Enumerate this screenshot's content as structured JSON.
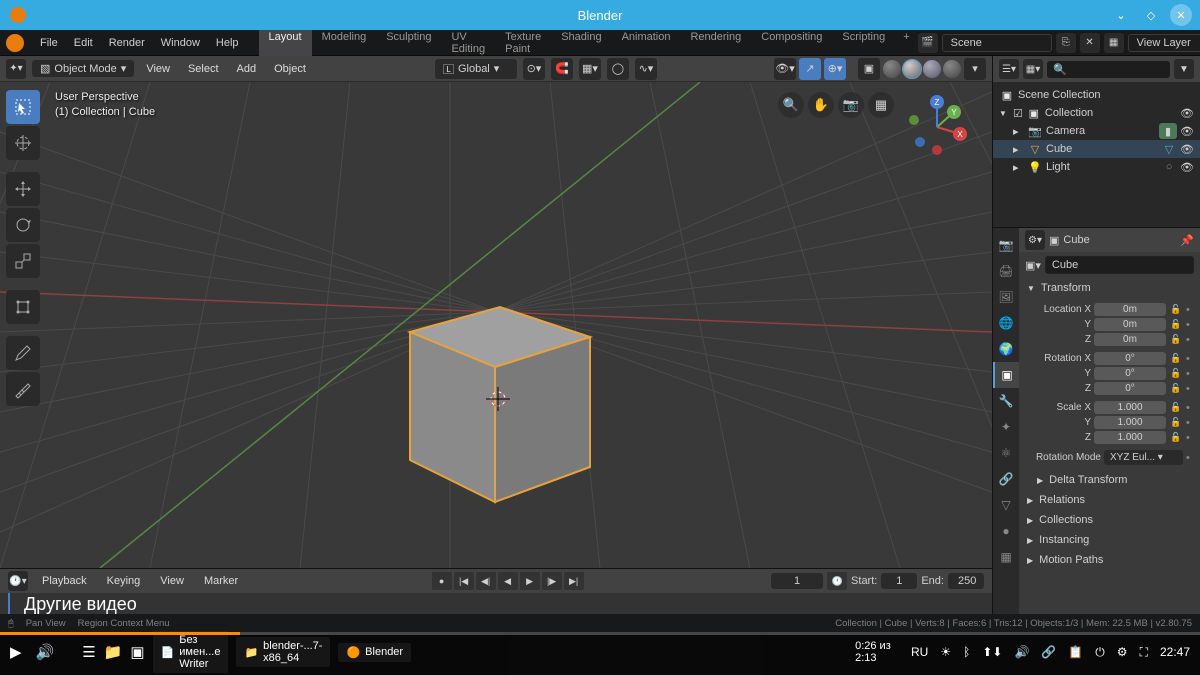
{
  "titlebar": {
    "title": "Blender"
  },
  "menu": {
    "file": "File",
    "edit": "Edit",
    "render": "Render",
    "window": "Window",
    "help": "Help"
  },
  "workspaces": {
    "layout": "Layout",
    "modeling": "Modeling",
    "sculpting": "Sculpting",
    "uv": "UV Editing",
    "texpaint": "Texture Paint",
    "shading": "Shading",
    "animation": "Animation",
    "rendering": "Rendering",
    "compositing": "Compositing",
    "scripting": "Scripting"
  },
  "scene": {
    "scene_label": "Scene",
    "layer_label": "View Layer"
  },
  "viewport_header": {
    "mode": "Object Mode",
    "view": "View",
    "select": "Select",
    "add": "Add",
    "object": "Object",
    "orientation": "Global"
  },
  "viewport_info": {
    "line1": "User Perspective",
    "line2": "(1) Collection | Cube"
  },
  "outliner": {
    "scene_collection": "Scene Collection",
    "collection": "Collection",
    "camera": "Camera",
    "cube": "Cube",
    "light": "Light"
  },
  "props": {
    "object_name": "Cube",
    "transform": "Transform",
    "loc_label": "Location X",
    "rot_label": "Rotation X",
    "scale_label": "Scale X",
    "y": "Y",
    "z": "Z",
    "loc_x": "0m",
    "loc_y": "0m",
    "loc_z": "0m",
    "rot_x": "0°",
    "rot_y": "0°",
    "rot_z": "0°",
    "scale_x": "1.000",
    "scale_y": "1.000",
    "scale_z": "1.000",
    "rotmode_label": "Rotation Mode",
    "rotmode": "XYZ Eul...",
    "delta": "Delta Transform",
    "relations": "Relations",
    "collections": "Collections",
    "instancing": "Instancing",
    "motion": "Motion Paths"
  },
  "timeline": {
    "playback": "Playback",
    "keying": "Keying",
    "view": "View",
    "marker": "Marker",
    "current": "1",
    "start_label": "Start:",
    "start": "1",
    "end_label": "End:",
    "end": "250"
  },
  "status": {
    "pan": "Pan View",
    "context": "Region Context Menu",
    "right": "Collection | Cube | Verts:8 | Faces:6 | Tris:12 | Objects:1/3 | Mem: 22.5 MB | v2.80.75"
  },
  "video": {
    "label": "Другие видео",
    "time": "0:26 из 2:13",
    "app1": "Без имен...e Writer",
    "app2": "blender-...7-x86_64",
    "app3": "Blender",
    "lang": "RU",
    "clock": "22:47"
  }
}
